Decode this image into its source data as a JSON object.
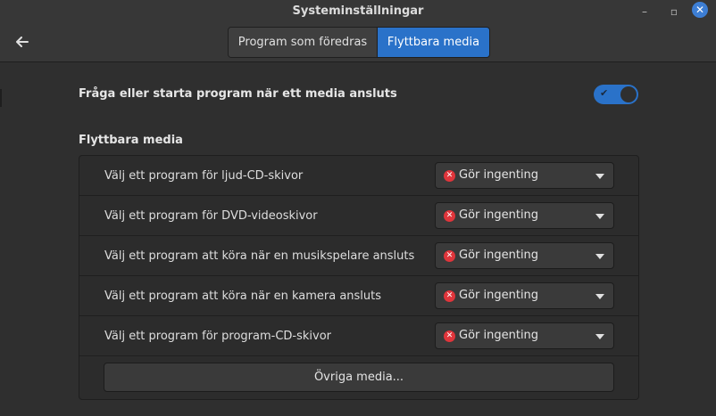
{
  "window": {
    "title": "Systeminställningar",
    "minimize_glyph": "–",
    "maximize_glyph": "▫",
    "close_glyph": "✕",
    "close_color": "#3d7ed4"
  },
  "header": {
    "back_icon": "back-arrow-icon",
    "tabs": [
      {
        "label": "Program som föredras",
        "active": false
      },
      {
        "label": "Flyttbara media",
        "active": true
      }
    ],
    "accent_color": "#2a72c9"
  },
  "auto_launch": {
    "label": "Fråga eller starta program när ett media ansluts",
    "enabled": true,
    "check_glyph": "✔"
  },
  "removable_media": {
    "heading": "Flyttbara media",
    "rows": [
      {
        "label": "Välj ett program för ljud-CD-skivor",
        "value": "Gör ingenting"
      },
      {
        "label": "Välj ett program för DVD-videoskivor",
        "value": "Gör ingenting"
      },
      {
        "label": "Välj ett program att köra när en musikspelare ansluts",
        "value": "Gör ingenting"
      },
      {
        "label": "Välj ett program att köra när en kamera ansluts",
        "value": "Gör ingenting"
      },
      {
        "label": "Välj ett program för program-CD-skivor",
        "value": "Gör ingenting"
      }
    ],
    "value_icon": "do-nothing-x-icon",
    "value_icon_glyph": "✕",
    "value_icon_color": "#e0353b",
    "other_button": "Övriga media..."
  }
}
